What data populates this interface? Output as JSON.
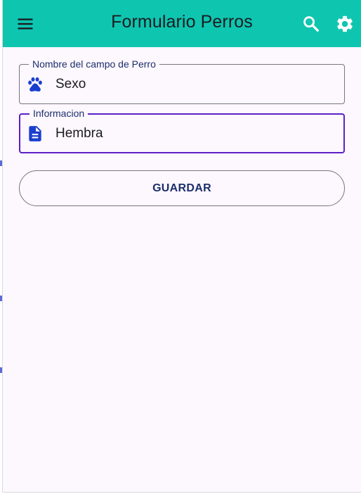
{
  "appbar": {
    "title": "Formulario Perros",
    "menu_icon": "hamburger-menu-icon",
    "search_icon": "search-icon",
    "settings_icon": "gear-icon",
    "background_color": "#0ec5b0"
  },
  "form": {
    "field_dog_name": {
      "label": "Nombre del campo de Perro",
      "value": "Sexo",
      "icon": "paw-icon"
    },
    "field_info": {
      "label": "Informacion",
      "value": "Hembra",
      "icon": "document-icon",
      "focused": true
    },
    "save_label": "GUARDAR"
  },
  "colors": {
    "accent": "#5c1fc7",
    "icon": "#1a3fcf",
    "surface": "#fdf7fe"
  }
}
